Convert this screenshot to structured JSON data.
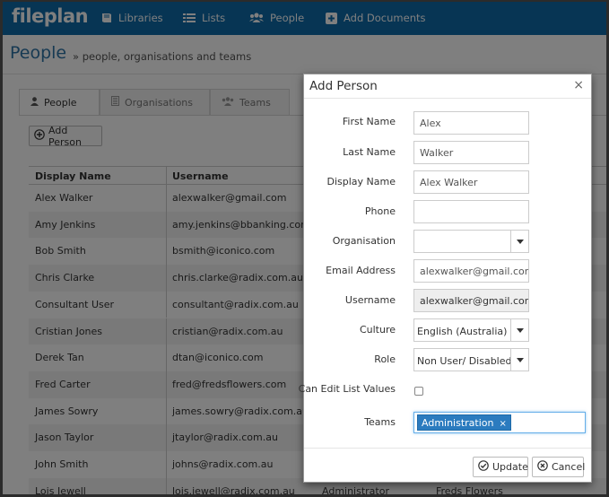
{
  "app": {
    "brand": "fileplan",
    "nav": [
      {
        "label": "Libraries",
        "icon": "book-icon"
      },
      {
        "label": "Lists",
        "icon": "list-icon"
      },
      {
        "label": "People",
        "icon": "users-icon"
      },
      {
        "label": "Add Documents",
        "icon": "plus-square-icon"
      }
    ]
  },
  "page": {
    "title": "People",
    "subtitle": "» people, organisations and teams"
  },
  "tabs": [
    {
      "label": "People",
      "icon": "user-icon",
      "active": true
    },
    {
      "label": "Organisations",
      "icon": "building-icon",
      "active": false
    },
    {
      "label": "Teams",
      "icon": "users-icon",
      "active": false
    }
  ],
  "toolbar": {
    "add_person": "Add Person"
  },
  "table": {
    "columns": [
      "Display Name",
      "Username"
    ],
    "rows": [
      {
        "name": "Alex Walker",
        "username": "alexwalker@gmail.com",
        "extra1": "",
        "extra2": ""
      },
      {
        "name": "Amy Jenkins",
        "username": "amy.jenkins@bbanking.com",
        "extra1": "",
        "extra2": ""
      },
      {
        "name": "Bob Smith",
        "username": "bsmith@iconico.com",
        "extra1": "",
        "extra2": ""
      },
      {
        "name": "Chris Clarke",
        "username": "chris.clarke@radix.com.au",
        "extra1": "",
        "extra2": ""
      },
      {
        "name": "Consultant User",
        "username": "consultant@radix.com.au",
        "extra1": "",
        "extra2": ""
      },
      {
        "name": "Cristian Jones",
        "username": "cristian@radix.com.au",
        "extra1": "",
        "extra2": ""
      },
      {
        "name": "Derek Tan",
        "username": "dtan@iconico.com",
        "extra1": "",
        "extra2": ""
      },
      {
        "name": "Fred Carter",
        "username": "fred@fredsflowers.com",
        "extra1": "",
        "extra2": ""
      },
      {
        "name": "James Sowry",
        "username": "james.sowry@radix.com.au",
        "extra1": "",
        "extra2": ""
      },
      {
        "name": "Jason Taylor",
        "username": "jtaylor@radix.com.au",
        "extra1": "",
        "extra2": ""
      },
      {
        "name": "John Smith",
        "username": "johns@radix.com.au",
        "extra1": "",
        "extra2": ""
      },
      {
        "name": "Lois Jewell",
        "username": "lois.jewell@radix.com.au",
        "extra1": "Administrator",
        "extra2": "Freds Flowers"
      }
    ]
  },
  "modal": {
    "title": "Add Person",
    "close_symbol": "×",
    "fields": {
      "first_name": {
        "label": "First Name",
        "value": "Alex"
      },
      "last_name": {
        "label": "Last Name",
        "value": "Walker"
      },
      "display_name": {
        "label": "Display Name",
        "value": "Alex Walker"
      },
      "phone": {
        "label": "Phone",
        "value": ""
      },
      "organisation": {
        "label": "Organisation",
        "value": ""
      },
      "email": {
        "label": "Email Address",
        "value": "alexwalker@gmail.com"
      },
      "username": {
        "label": "Username",
        "value": "alexwalker@gmail.com"
      },
      "culture": {
        "label": "Culture",
        "value": "English (Australia)"
      },
      "role": {
        "label": "Role",
        "value": "Non User/ Disabled"
      },
      "can_edit": {
        "label": "Can Edit List Values",
        "checked": false
      },
      "teams": {
        "label": "Teams",
        "tags": [
          "Administration"
        ],
        "remove_symbol": "×"
      }
    },
    "buttons": {
      "update": "Update",
      "cancel": "Cancel"
    }
  },
  "colors": {
    "nav_bg": "#0e6aa8",
    "title": "#2f74a6",
    "tag_bg": "#2b7bbf",
    "focus": "#66afe9"
  }
}
